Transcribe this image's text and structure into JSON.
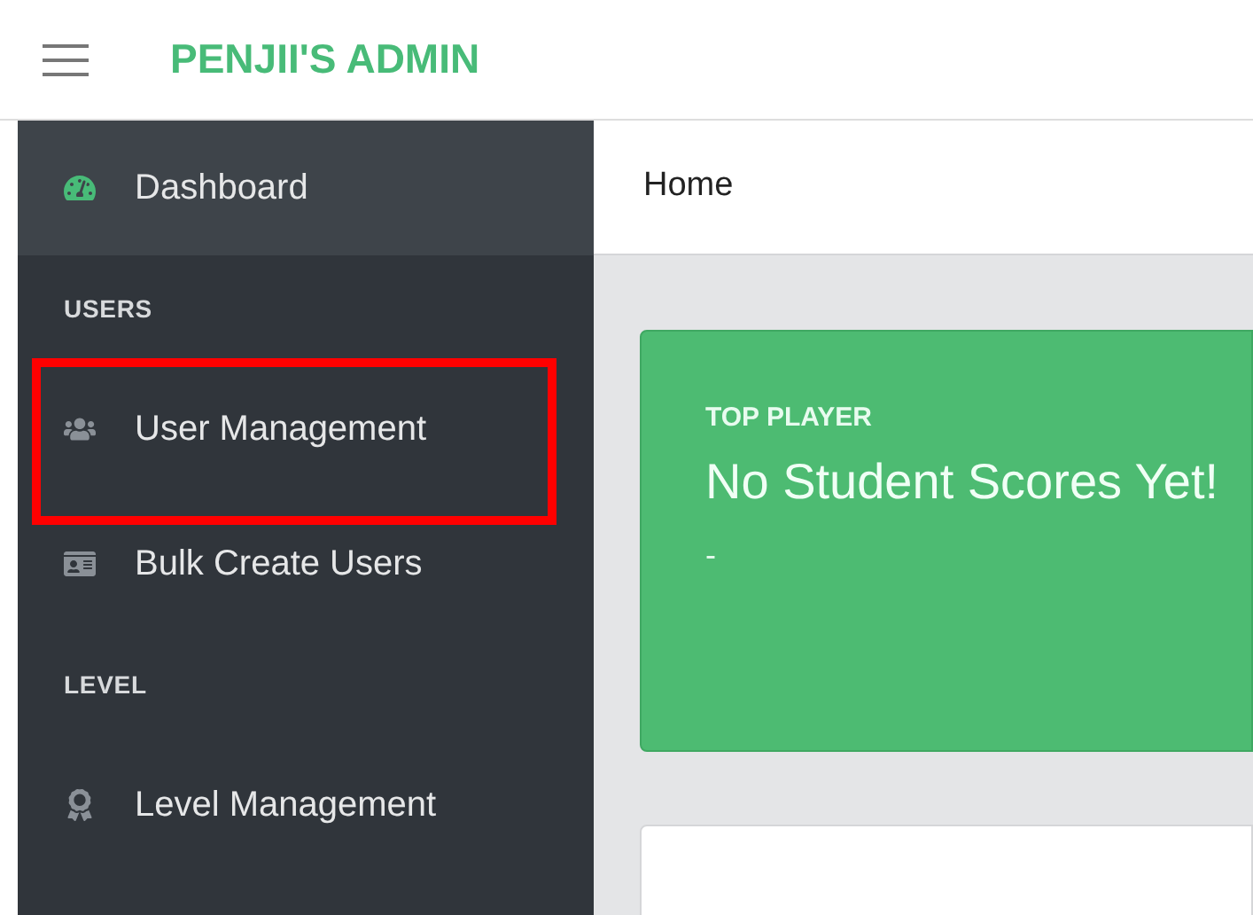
{
  "header": {
    "title": "PENJII'S ADMIN"
  },
  "sidebar": {
    "items": [
      {
        "kind": "link",
        "label": "Dashboard",
        "selected": true,
        "highlighted": false
      },
      {
        "kind": "heading",
        "label": "USERS"
      },
      {
        "kind": "link",
        "label": "User Management",
        "selected": false,
        "highlighted": true
      },
      {
        "kind": "link",
        "label": "Bulk Create Users",
        "selected": false,
        "highlighted": false
      },
      {
        "kind": "heading",
        "label": "LEVEL"
      },
      {
        "kind": "link",
        "label": "Level Management",
        "selected": false,
        "highlighted": false
      }
    ]
  },
  "breadcrumb": [
    "Home"
  ],
  "top_player": {
    "label": "TOP PLAYER",
    "value": "No Student Scores Yet!",
    "detail": "-"
  }
}
